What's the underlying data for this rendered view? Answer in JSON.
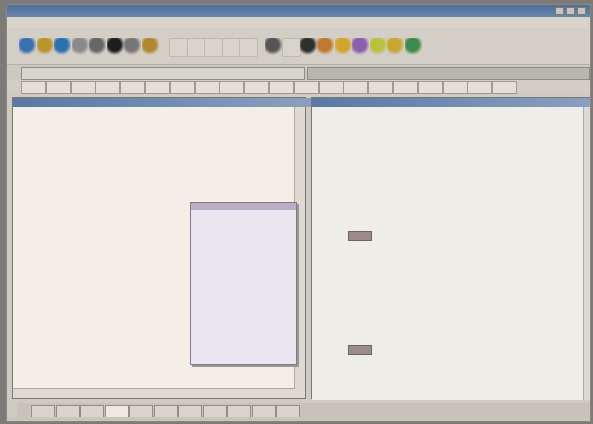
{
  "window": {
    "title": ""
  },
  "menu": [
    "",
    "",
    "",
    "",
    "",
    "",
    "",
    ""
  ],
  "toolbar": {
    "icons": [
      "new-icon",
      "open-icon",
      "save-icon",
      "cut-icon",
      "print-icon",
      "find-icon",
      "view-icon",
      "undo-icon",
      "blank-icon",
      "blank-icon",
      "blank-icon",
      "blank-icon",
      "blank-icon",
      "bold-icon",
      "blank-icon",
      "italic-icon",
      "underline-icon",
      "link-icon",
      "image-icon",
      "table-icon",
      "form-icon",
      "frame-icon"
    ]
  },
  "documents": [
    {
      "label": "",
      "active": true
    },
    {
      "label": "",
      "active": false
    }
  ],
  "tag_buttons": [
    "",
    "",
    "",
    "",
    "",
    "",
    "",
    "",
    "",
    "",
    "",
    "",
    "",
    "",
    "",
    "",
    "",
    "",
    "",
    ""
  ],
  "left_pane": {
    "title": "",
    "lines": [
      "",
      "",
      "",
      "",
      "",
      "",
      "",
      "",
      "",
      "",
      "",
      "",
      "",
      "",
      "",
      "",
      "",
      "",
      "",
      "",
      "",
      "",
      "",
      "",
      "",
      "",
      "",
      "",
      "",
      "",
      "",
      ""
    ],
    "autocomplete": [
      "",
      "",
      "",
      "",
      "",
      "",
      "",
      "",
      "",
      "",
      "",
      "",
      "",
      "",
      "",
      "",
      "",
      "",
      "",
      "",
      "",
      ""
    ]
  },
  "right_pane": {
    "title": "",
    "blocks": [
      {
        "lines": [
          "",
          "",
          "",
          "",
          "",
          "",
          "",
          "",
          "",
          "",
          "",
          "",
          ""
        ]
      },
      {
        "lines": [
          "",
          "",
          "",
          "",
          "",
          "",
          "",
          "",
          "",
          "",
          "",
          "",
          "",
          ""
        ]
      },
      {
        "lines": [
          "",
          "",
          "",
          "",
          "",
          ""
        ]
      }
    ]
  },
  "bottom_tabs": [
    "",
    "",
    "",
    "",
    "",
    "",
    "",
    "",
    "",
    "",
    ""
  ],
  "status": {
    "left": "",
    "middle": "",
    "right": ""
  },
  "colors": {
    "title_bar": "#4e6f9a",
    "code_tag": "#2b2f9a",
    "code_highlight": "#d9cfee",
    "preview_marker": "#9b8c8a"
  }
}
